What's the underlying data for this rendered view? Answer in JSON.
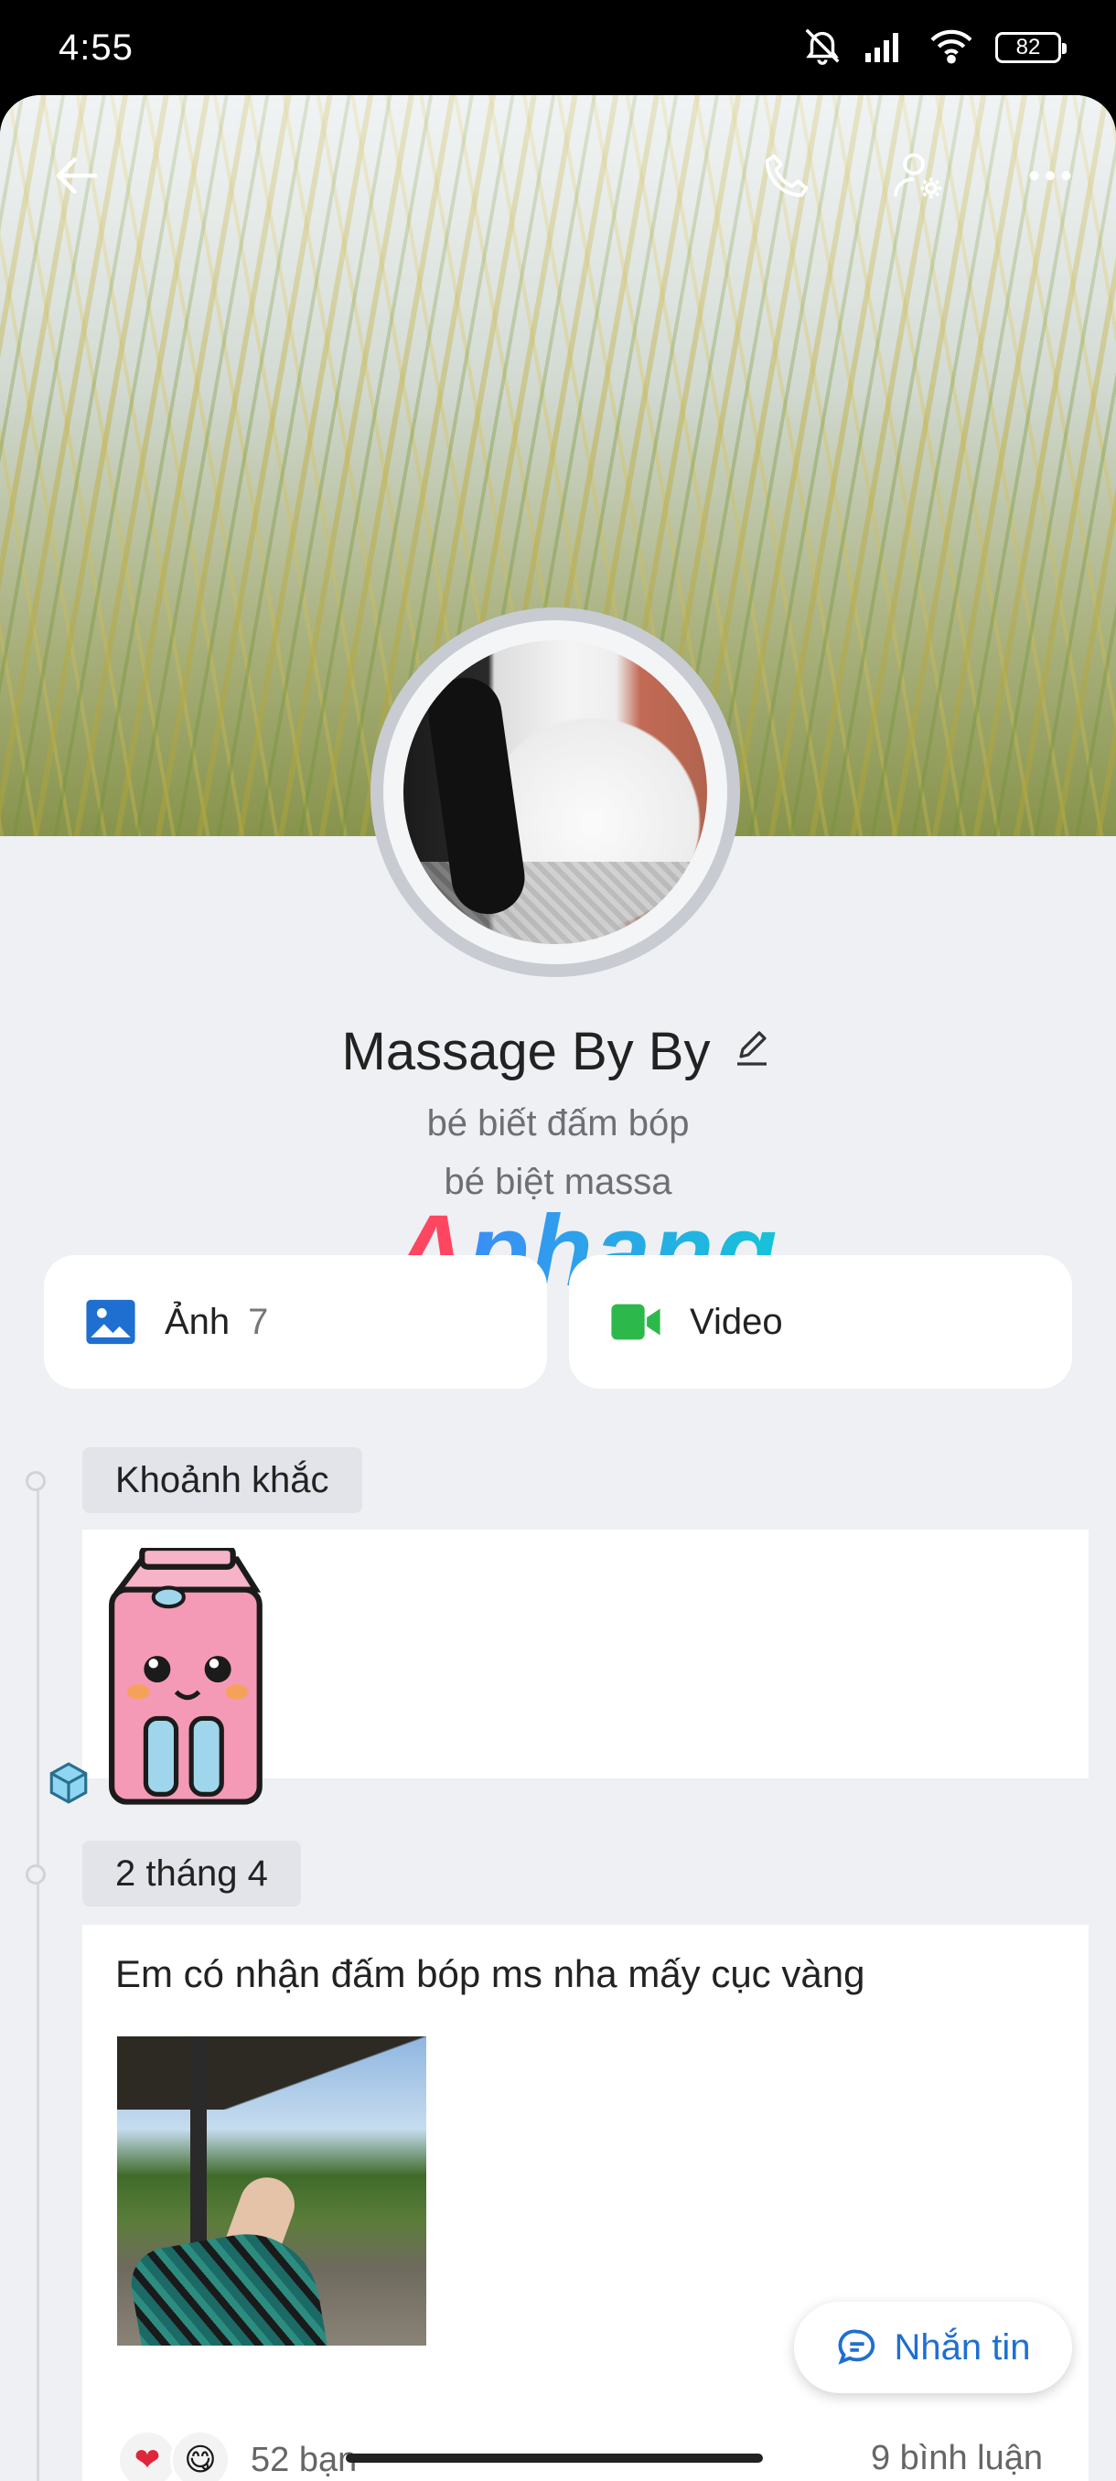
{
  "status_bar": {
    "time": "4:55",
    "battery": "82",
    "icons": [
      "mute-icon",
      "signal-icon",
      "wifi-icon",
      "battery-icon"
    ]
  },
  "header": {
    "icons": [
      "back-arrow-icon",
      "phone-icon",
      "user-settings-icon",
      "more-icon"
    ]
  },
  "profile": {
    "name": "Massage By By",
    "bio_line1": "bé biết đấm bóp",
    "bio_line2": "bé biệt massa",
    "watermark": "Aphang"
  },
  "media": {
    "photos_label": "Ảnh",
    "photos_count": "7",
    "video_label": "Video"
  },
  "timeline": {
    "moments_tag": "Khoảnh khắc",
    "date_tag": "2 tháng 4"
  },
  "post": {
    "text": "Em có nhận đấm bóp ms nha mấy cục vàng",
    "reactions": [
      "❤",
      "😋"
    ],
    "friends": "52 bạn",
    "comments": "9 bình luận"
  },
  "message_button": "Nhắn tin",
  "colors": {
    "accent": "#1f6fd1",
    "background": "#eef0f4",
    "video_green": "#2db84b"
  }
}
